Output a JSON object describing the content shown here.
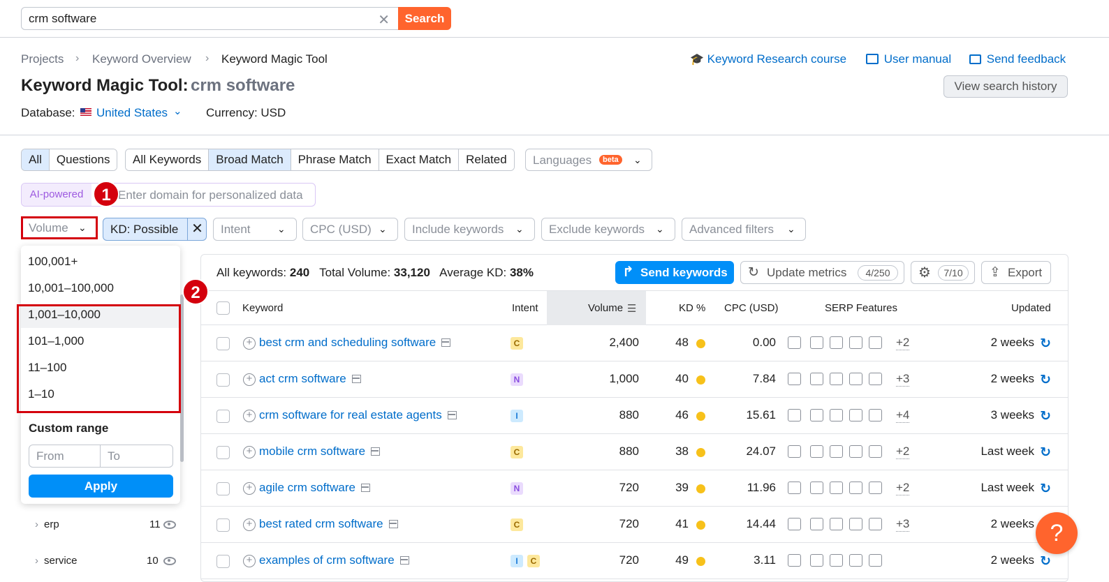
{
  "search": {
    "value": "crm software",
    "button": "Search"
  },
  "breadcrumb": [
    "Projects",
    "Keyword Overview",
    "Keyword Magic Tool"
  ],
  "header": {
    "title": "Keyword Magic Tool:",
    "query": "crm software",
    "database_label": "Database:",
    "database_value": "United States",
    "currency": "Currency: USD",
    "links": {
      "course": "Keyword Research course",
      "manual": "User manual",
      "feedback": "Send feedback"
    },
    "history_button": "View search history"
  },
  "tabs": {
    "type": [
      "All",
      "Questions"
    ],
    "match": [
      "All Keywords",
      "Broad Match",
      "Phrase Match",
      "Exact Match",
      "Related"
    ],
    "languages": "Languages",
    "beta": "beta"
  },
  "ai": {
    "tag": "AI-powered",
    "placeholder": "Enter domain for personalized data"
  },
  "badges": {
    "one": "1",
    "two": "2"
  },
  "filters": {
    "volume": "Volume",
    "kd": "KD: Possible",
    "intent": "Intent",
    "cpc": "CPC (USD)",
    "include": "Include keywords",
    "exclude": "Exclude keywords",
    "advanced": "Advanced filters"
  },
  "volume_dropdown": {
    "options": [
      "100,001+",
      "10,001–100,000",
      "1,001–10,000",
      "101–1,000",
      "11–100",
      "1–10"
    ],
    "custom_range": "Custom range",
    "from": "From",
    "to": "To",
    "apply": "Apply"
  },
  "groups": [
    {
      "name": "erp",
      "count": "11"
    },
    {
      "name": "service",
      "count": "10"
    }
  ],
  "summary": {
    "all_label": "All keywords:",
    "all_value": "240",
    "volume_label": "Total Volume:",
    "volume_value": "33,120",
    "kd_label": "Average KD:",
    "kd_value": "38%"
  },
  "actions": {
    "send": "Send keywords",
    "update": "Update metrics",
    "update_count": "4/250",
    "settings_count": "7/10",
    "export": "Export"
  },
  "columns": [
    "Keyword",
    "Intent",
    "Volume",
    "KD %",
    "CPC (USD)",
    "SERP Features",
    "Updated"
  ],
  "rows": [
    {
      "keyword": "best crm and scheduling software",
      "intent": [
        "C"
      ],
      "volume": "2,400",
      "kd": "48",
      "cpc": "0.00",
      "more": "+2",
      "updated": "2 weeks"
    },
    {
      "keyword": "act crm software",
      "intent": [
        "N"
      ],
      "volume": "1,000",
      "kd": "40",
      "cpc": "7.84",
      "more": "+3",
      "updated": "2 weeks"
    },
    {
      "keyword": "crm software for real estate agents",
      "intent": [
        "I"
      ],
      "volume": "880",
      "kd": "46",
      "cpc": "15.61",
      "more": "+4",
      "updated": "3 weeks"
    },
    {
      "keyword": "mobile crm software",
      "intent": [
        "C"
      ],
      "volume": "880",
      "kd": "38",
      "cpc": "24.07",
      "more": "+2",
      "updated": "Last week"
    },
    {
      "keyword": "agile crm software",
      "intent": [
        "N"
      ],
      "volume": "720",
      "kd": "39",
      "cpc": "11.96",
      "more": "+2",
      "updated": "Last week"
    },
    {
      "keyword": "best rated crm software",
      "intent": [
        "C"
      ],
      "volume": "720",
      "kd": "41",
      "cpc": "14.44",
      "more": "+3",
      "updated": "2 weeks"
    },
    {
      "keyword": "examples of crm software",
      "intent": [
        "I",
        "C"
      ],
      "volume": "720",
      "kd": "49",
      "cpc": "3.11",
      "more": "",
      "updated": "2 weeks"
    }
  ],
  "help": "?"
}
